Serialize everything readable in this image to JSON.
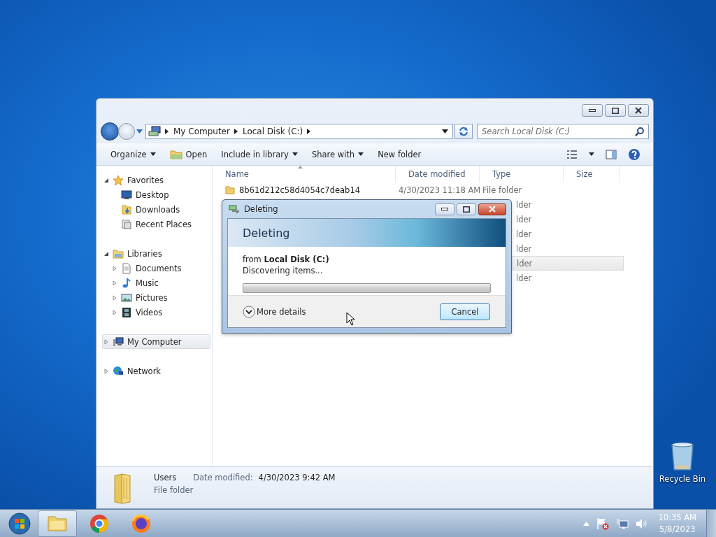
{
  "explorer": {
    "address": {
      "path": [
        "My Computer",
        "Local Disk (C:)"
      ],
      "search_placeholder": "Search Local Disk (C:)"
    },
    "toolbar": [
      {
        "label": "Organize",
        "dropdown": true,
        "kind": "plain"
      },
      {
        "label": "Open",
        "dropdown": false,
        "kind": "open"
      },
      {
        "label": "Include in library",
        "dropdown": true,
        "kind": "plain"
      },
      {
        "label": "Share with",
        "dropdown": true,
        "kind": "plain"
      },
      {
        "label": "New folder",
        "dropdown": false,
        "kind": "plain"
      }
    ],
    "sidebar": [
      {
        "label": "Favorites",
        "kind": "star",
        "expanded": true,
        "selected": false,
        "children": [
          {
            "label": "Desktop",
            "kind": "desktop"
          },
          {
            "label": "Downloads",
            "kind": "download"
          },
          {
            "label": "Recent Places",
            "kind": "recent"
          }
        ]
      },
      {
        "label": "Libraries",
        "kind": "library",
        "expanded": true,
        "selected": false,
        "children": [
          {
            "label": "Documents",
            "kind": "document",
            "expanded": false
          },
          {
            "label": "Music",
            "kind": "music",
            "expanded": false
          },
          {
            "label": "Pictures",
            "kind": "picture",
            "expanded": false
          },
          {
            "label": "Videos",
            "kind": "video",
            "expanded": false
          }
        ]
      },
      {
        "label": "My Computer",
        "kind": "computer",
        "expanded": false,
        "selected": true
      },
      {
        "label": "Network",
        "kind": "network",
        "expanded": false,
        "selected": false
      }
    ],
    "columns": [
      "Name",
      "Date modified",
      "Type",
      "Size"
    ],
    "rows": [
      {
        "name": "8b61d212c58d4054c7deab14",
        "date": "4/30/2023 11:18 AM",
        "type": "File folder",
        "selected": false
      },
      {
        "type": "lder",
        "selected": false
      },
      {
        "type": "lder",
        "selected": false
      },
      {
        "type": "lder",
        "selected": false
      },
      {
        "type": "lder",
        "selected": false
      },
      {
        "type": "lder",
        "selected": true
      },
      {
        "type": "lder",
        "selected": false
      }
    ],
    "details": {
      "name": "Users",
      "type": "File folder",
      "date_label": "Date modified:",
      "date": "4/30/2023 9:42 AM"
    }
  },
  "dialog": {
    "title": "Deleting",
    "heading": "Deleting",
    "source": "from **Local Disk (C:)**",
    "status": "Discovering items...",
    "progress": {
      "level": 0
    },
    "more_details": "More details",
    "expanded": false,
    "cancel": "Cancel"
  },
  "desktop_icons": [
    {
      "label": "Recycle Bin"
    }
  ],
  "taskbar": {
    "apps": [
      {
        "kind": "explorer",
        "active": true
      },
      {
        "kind": "chrome",
        "active": false
      },
      {
        "kind": "firefox",
        "active": false
      }
    ],
    "clock": {
      "time": "10:35 AM",
      "date": "5/8/2023"
    }
  }
}
